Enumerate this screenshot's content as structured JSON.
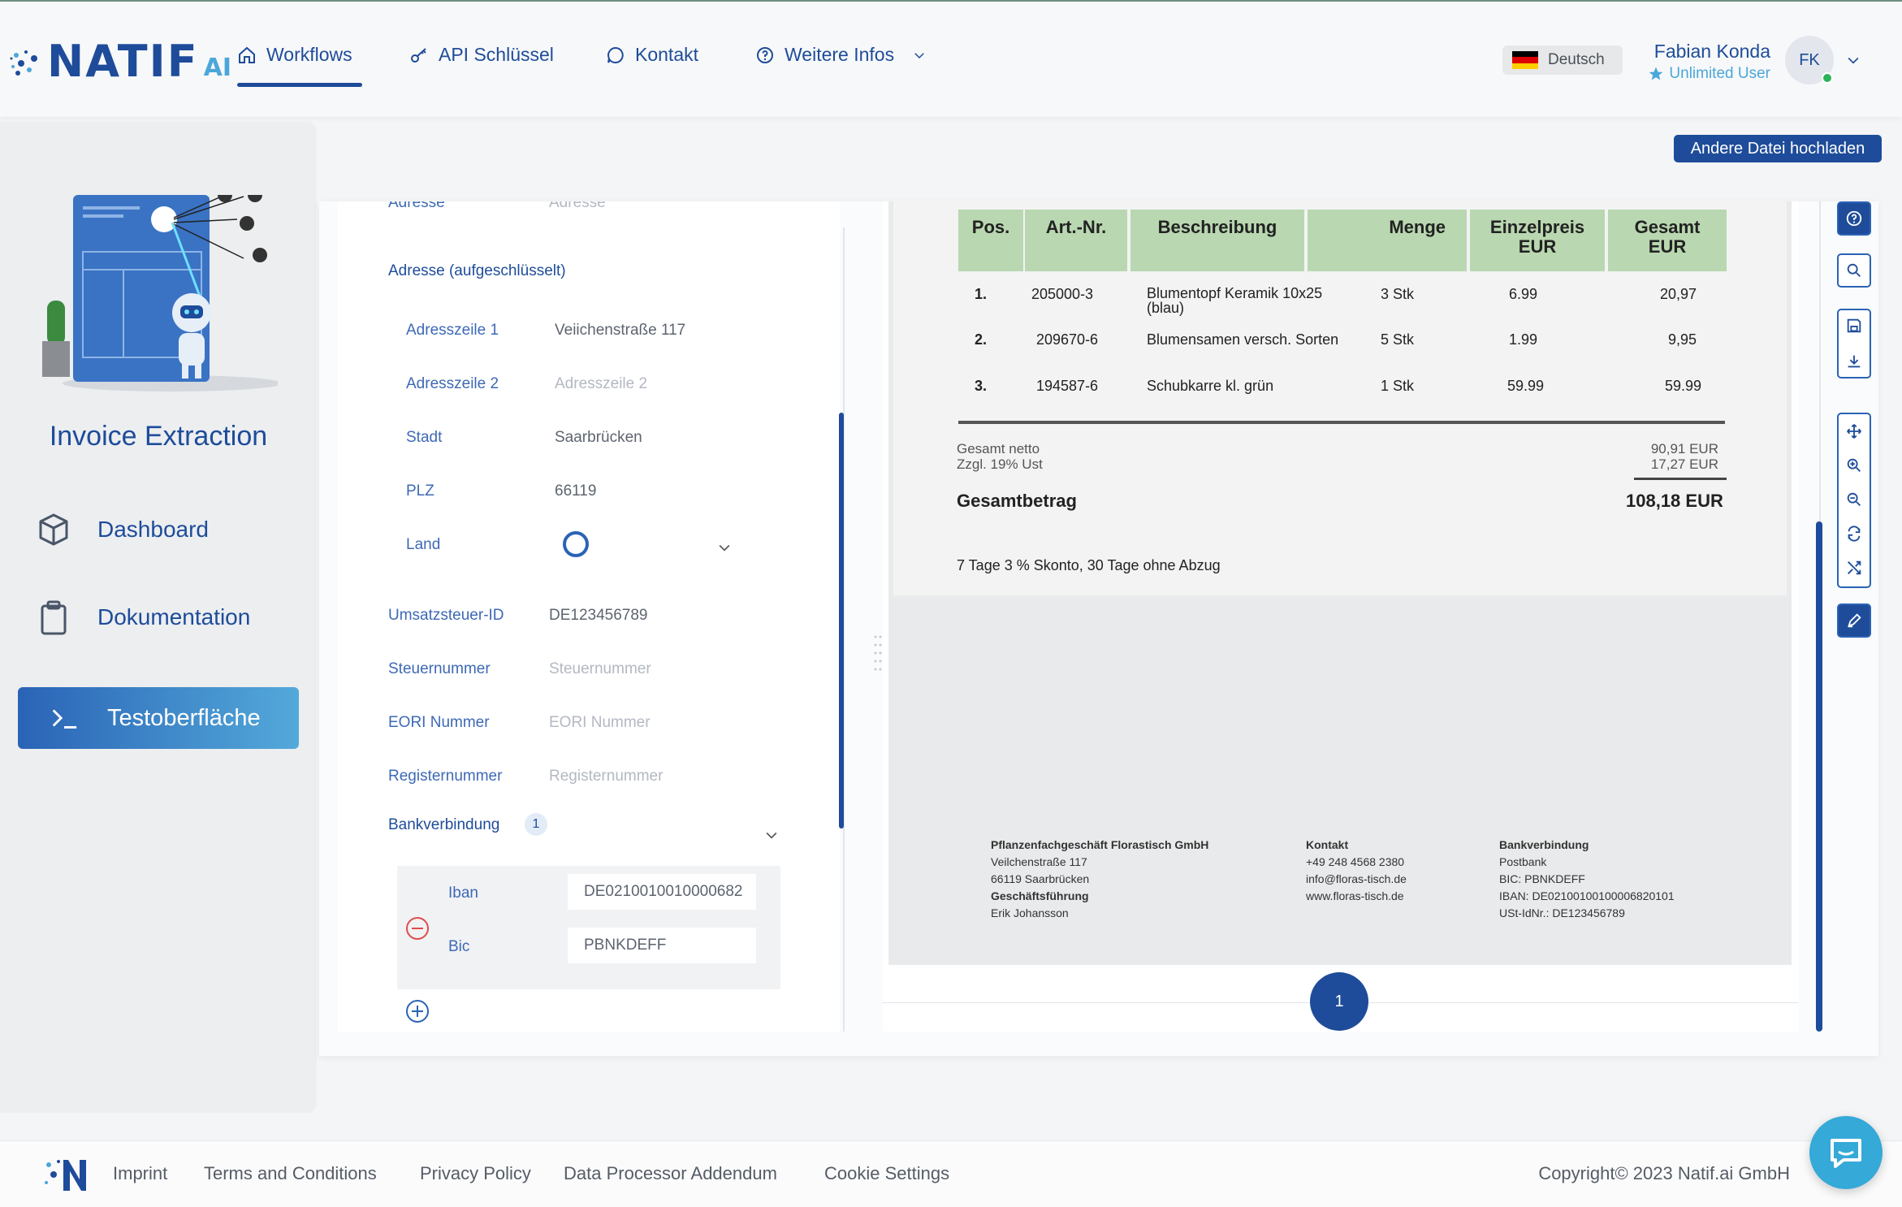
{
  "brand": {
    "logo_word": "NATIF",
    "logo_ai": "AI"
  },
  "nav": {
    "workflows": "Workflows",
    "api_keys": "API Schlüssel",
    "contact": "Kontakt",
    "more_info": "Weitere Infos"
  },
  "language": "Deutsch",
  "user": {
    "name": "Fabian Konda",
    "role": "Unlimited User",
    "initials": "FK"
  },
  "sidebar": {
    "title": "Invoice Extraction",
    "items": [
      {
        "label": "Dashboard",
        "icon": "cube-icon"
      },
      {
        "label": "Dokumentation",
        "icon": "clipboard-icon"
      },
      {
        "label": "Testoberfläche",
        "icon": "terminal-icon"
      }
    ]
  },
  "upload_button": "Andere Datei hochladen",
  "form": {
    "cut_label": "Adresse",
    "cut_placeholder": "Adresse",
    "address_section": "Adresse (aufgeschlüsselt)",
    "fields": {
      "addr1_label": "Adresszeile 1",
      "addr1_value": "Veiichenstraße 117",
      "addr2_label": "Adresszeile 2",
      "addr2_placeholder": "Adresszeile 2",
      "city_label": "Stadt",
      "city_value": "Saarbrücken",
      "zip_label": "PLZ",
      "zip_value": "66119",
      "country_label": "Land",
      "vat_label": "Umsatzsteuer-ID",
      "vat_value": "DE123456789",
      "tax_label": "Steuernummer",
      "tax_placeholder": "Steuernummer",
      "eori_label": "EORI Nummer",
      "eori_placeholder": "EORI Nummer",
      "reg_label": "Registernummer",
      "reg_placeholder": "Registernummer"
    },
    "bank": {
      "section": "Bankverbindung",
      "count": "1",
      "iban_label": "Iban",
      "iban_value": "DE0210010010000682",
      "bic_label": "Bic",
      "bic_value": "PBNKDEFF"
    }
  },
  "document": {
    "headers": [
      "Pos.",
      "Art.-Nr.",
      "Beschreibung",
      "Menge",
      "Einzelpreis",
      "Gesamt"
    ],
    "header_sub": "EUR",
    "rows": [
      {
        "pos": "1.",
        "art": "205000-3",
        "desc": "Blumentopf Keramik 10x25",
        "desc2": "(blau)",
        "qty": "3 Stk",
        "unit": "6.99",
        "total": "20,97"
      },
      {
        "pos": "2.",
        "art": "209670-6",
        "desc": "Blumensamen versch. Sorten",
        "desc2": "",
        "qty": "5 Stk",
        "unit": "1.99",
        "total": "9,95"
      },
      {
        "pos": "3.",
        "art": "194587-6",
        "desc": "Schubkarre kl. grün",
        "desc2": "",
        "qty": "1 Stk",
        "unit": "59.99",
        "total": "59.99"
      }
    ],
    "net_label": "Gesamt netto",
    "net_value": "90,91 EUR",
    "vat_label": "Zzgl. 19% Ust",
    "vat_value": "17,27 EUR",
    "total_label": "Gesamtbetrag",
    "total_value": "108,18 EUR",
    "terms": "7 Tage 3 % Skonto, 30 Tage ohne Abzug",
    "footer": {
      "company": "Pflanzenfachgeschäft Florastisch GmbH",
      "street": "Veilchenstraße 117",
      "city": "66119 Saarbrücken",
      "mgmt_title": "Geschäftsführung",
      "mgmt_name": "Erik Johansson",
      "contact_title": "Kontakt",
      "phone": "+49 248 4568 2380",
      "email": "info@floras-tisch.de",
      "web": "www.floras-tisch.de",
      "bank_title": "Bankverbindung",
      "bank_name": "Postbank",
      "bic": "BIC: PBNKDEFF",
      "iban": "IBAN: DE02100100100006820101",
      "ustid": "USt-IdNr.: DE123456789"
    },
    "page_number": "1"
  },
  "footer": {
    "links": [
      "Imprint",
      "Terms and Conditions",
      "Privacy Policy",
      "Data Processor Addendum",
      "Cookie Settings"
    ],
    "copyright": "Copyright© 2023 Natif.ai GmbH"
  },
  "colors": {
    "primary": "#1e4c9a",
    "accent": "#4ba7d9",
    "table_header": "#b9d7b0",
    "online": "#2db35a"
  }
}
